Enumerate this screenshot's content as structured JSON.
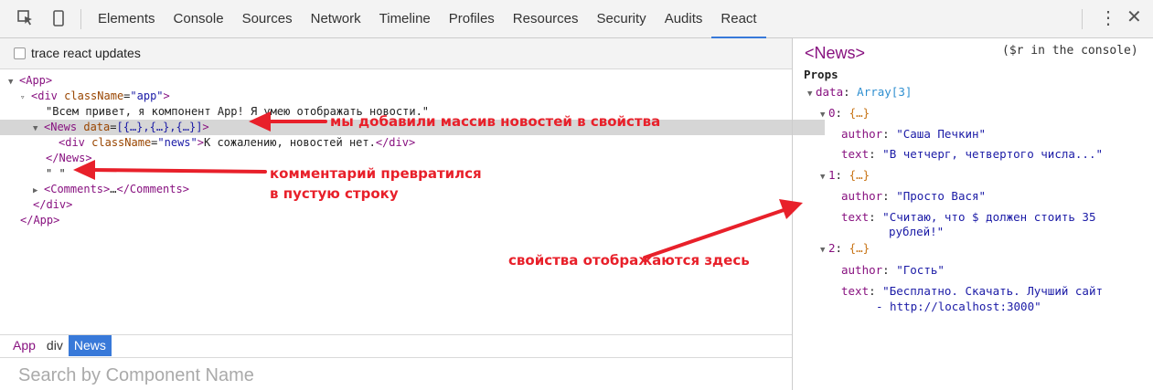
{
  "toolbar": {
    "tabs": [
      "Elements",
      "Console",
      "Sources",
      "Network",
      "Timeline",
      "Profiles",
      "Resources",
      "Security",
      "Audits",
      "React"
    ],
    "active_tab": "React",
    "kebab": "⋮",
    "close": "✕"
  },
  "left": {
    "trace_label": "trace react updates",
    "tree": {
      "app_open": "<App>",
      "div_tag": "<div",
      "div_attr": "className",
      "div_val": "\"app\"",
      "div_close": ">",
      "greeting": "\"Всем привет, я компонент App! Я умею отображать новости.\"",
      "news_tag": "<News",
      "news_attr": "data",
      "news_val": "[{…},{…},{…}]",
      "news_close": ">",
      "inner_div": "<div",
      "inner_attr": "className",
      "inner_val": "\"news\"",
      "inner_close": ">",
      "inner_text": "К сожалению, новостей нет.",
      "inner_end": "</div>",
      "news_end": "</News>",
      "empty_string": "\" \"",
      "comments_open": "<Comments>",
      "comments_dots": "…",
      "comments_end": "</Comments>",
      "div_end": "</div>",
      "app_end": "</App>"
    },
    "breadcrumb": [
      "App",
      "div",
      "News"
    ],
    "search_placeholder": "Search by Component Name"
  },
  "right": {
    "title": "<News>",
    "hint": "($r in the console)",
    "props_label": "Props",
    "data_key": "data",
    "data_type": "Array[3]",
    "items": [
      {
        "index": "0",
        "obj": "{…}",
        "author": "\"Саша Печкин\"",
        "text_lines": [
          "\"В четчерг, четвертого числа...\""
        ]
      },
      {
        "index": "1",
        "obj": "{…}",
        "author": "\"Просто Вася\"",
        "text_lines": [
          "\"Считаю, что $ должен стоить 35",
          "рублей!\""
        ]
      },
      {
        "index": "2",
        "obj": "{…}",
        "author": "\"Гость\"",
        "text_lines": [
          "\"Бесплатно. Скачать. Лучший сайт",
          "- http://localhost:3000\""
        ]
      }
    ],
    "author_key": "author",
    "text_key": "text"
  },
  "annotations": {
    "a1": "мы добавили массив новостей в свойства",
    "a2_line1": "комментарий превратился",
    "a2_line2": "в пустую строку",
    "a3": "свойства отображаются здесь"
  },
  "colors": {
    "annotation": "#e8202a",
    "tag": "#881280",
    "accent": "#3879d9"
  }
}
